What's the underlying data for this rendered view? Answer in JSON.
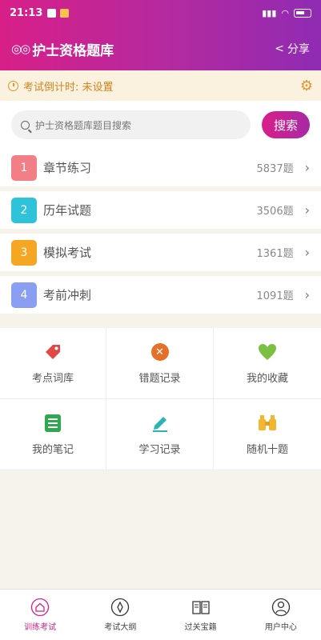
{
  "status_bar": {
    "time": "21:13"
  },
  "header": {
    "title": "护士资格题库",
    "share_label": "分享"
  },
  "countdown": {
    "label": "考试倒计时: 未设置"
  },
  "search": {
    "placeholder": "护士资格题库题目搜索",
    "button_label": "搜索"
  },
  "categories": [
    {
      "number": "1",
      "name": "章节练习",
      "count": "5837题",
      "color": "#f27e86"
    },
    {
      "number": "2",
      "name": "历年试题",
      "count": "3506题",
      "color": "#2fc3d9"
    },
    {
      "number": "3",
      "name": "模拟考试",
      "count": "1361题",
      "color": "#f5a623"
    },
    {
      "number": "4",
      "name": "考前冲刺",
      "count": "1091题",
      "color": "#8a9ff2"
    }
  ],
  "tools": [
    {
      "label": "考点词库",
      "icon": "tag-icon",
      "color": "#e04a45"
    },
    {
      "label": "错题记录",
      "icon": "circle-x-icon",
      "color": "#e6702a"
    },
    {
      "label": "我的收藏",
      "icon": "heart-icon",
      "color": "#7bc043"
    },
    {
      "label": "我的笔记",
      "icon": "note-icon",
      "color": "#2fa84f"
    },
    {
      "label": "学习记录",
      "icon": "pencil-icon",
      "color": "#29b5b8"
    },
    {
      "label": "随机十题",
      "icon": "binoculars-icon",
      "color": "#f2b632"
    }
  ],
  "tabs": [
    {
      "label": "训练考试",
      "icon": "home-icon",
      "active": true
    },
    {
      "label": "考试大纲",
      "icon": "compass-icon",
      "active": false
    },
    {
      "label": "过关宝籍",
      "icon": "book-icon",
      "active": false
    },
    {
      "label": "用户中心",
      "icon": "user-icon",
      "active": false
    }
  ],
  "colors": {
    "brand_start": "#d81f88",
    "brand_end": "#8f2bb3",
    "countdown_text": "#d5841f",
    "page_bg": "#f6f3ea"
  }
}
